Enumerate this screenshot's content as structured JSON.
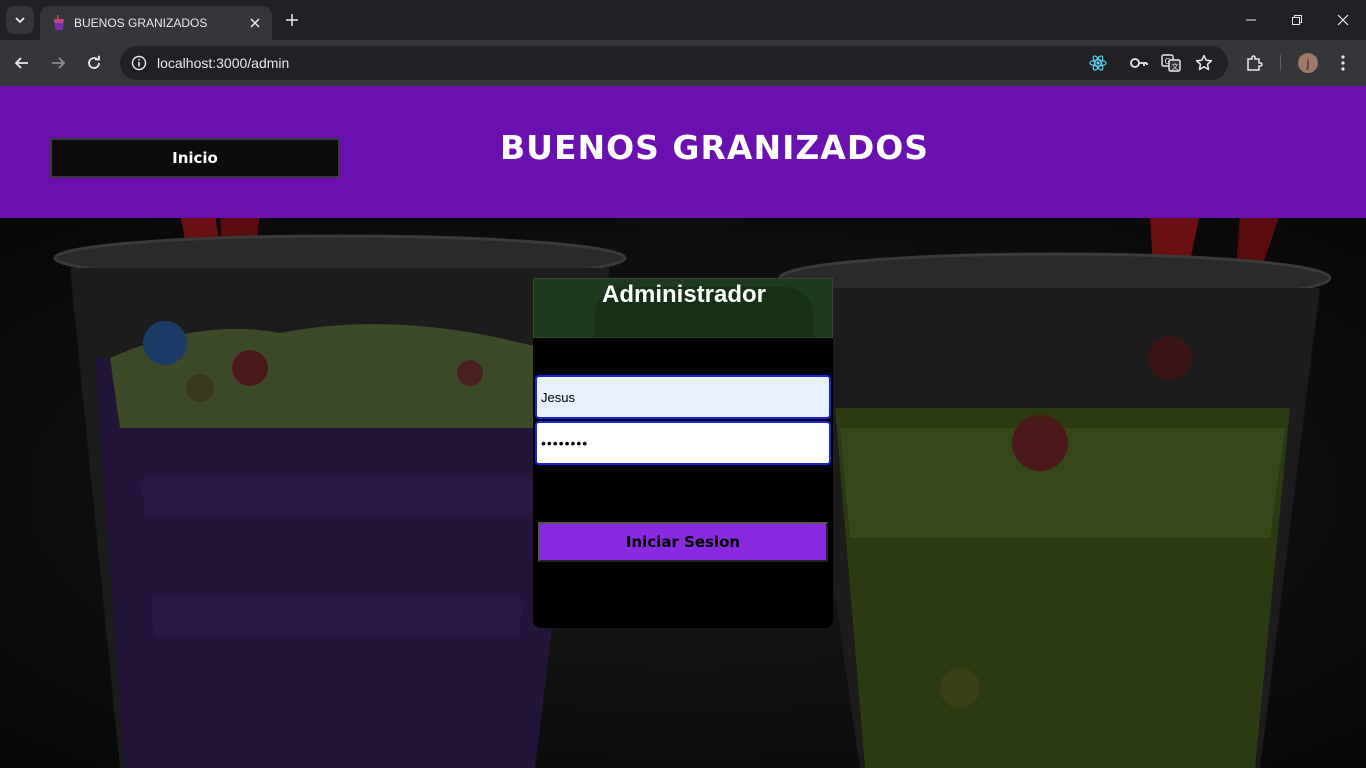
{
  "browser": {
    "tab_title": "BUENOS GRANIZADOS",
    "url": "localhost:3000/admin",
    "profile_initial": "j"
  },
  "header": {
    "inicio_label": "Inicio",
    "brand": "BUENOS GRANIZADOS",
    "background_color": "#6a0fb0"
  },
  "login": {
    "title": "Administrador",
    "username_value": "Jesus",
    "password_value": "••••••••",
    "submit_label": "Iniciar Sesion",
    "button_color": "#8a2ae0"
  },
  "icons": {
    "tab_search": "chevron-down-icon",
    "back": "arrow-left-icon",
    "forward": "arrow-right-icon",
    "reload": "reload-icon",
    "site_info": "info-icon",
    "react": "react-devtools-icon",
    "password": "key-icon",
    "translate": "translate-icon",
    "bookmark": "star-icon",
    "extensions": "puzzle-icon",
    "menu": "kebab-menu-icon"
  }
}
